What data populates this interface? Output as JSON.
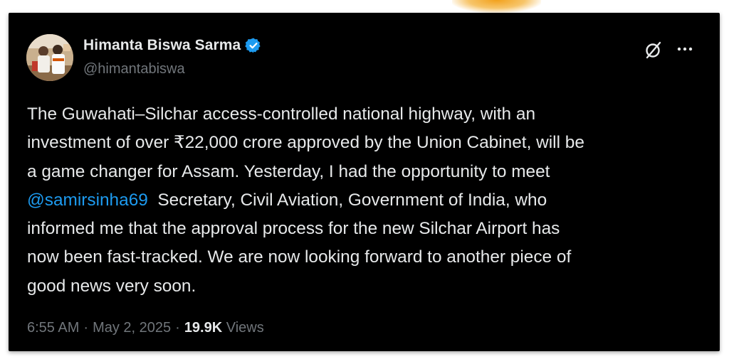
{
  "colors": {
    "card_background": "#000000",
    "text_primary": "#e7e9ea",
    "text_secondary": "#71767b",
    "mention_link": "#1d9bf0",
    "verified_badge": "#1d9bf0",
    "page_background": "#ffffff"
  },
  "tweet": {
    "author": {
      "name": "Himanta Biswa Sarma",
      "handle": "@himantabiswa",
      "verified_icon": "verified-badge-icon",
      "avatar": "profile-photo"
    },
    "actions": {
      "grok_icon": "grok-icon",
      "more_icon": "more-options-icon"
    },
    "body": {
      "line1": "The Guwahati–Silchar access-controlled national highway, with an",
      "line2": "investment of over ₹22,000 crore approved by the Union Cabinet, will be",
      "line3": "a game changer for Assam. Yesterday, I had the opportunity to meet",
      "mention": "@samirsinha69",
      "line4_rest": "  Secretary, Civil Aviation, Government of India, who",
      "line5": "informed me that the approval process for the new Silchar Airport has",
      "line6": "now been fast-tracked. We are now looking forward to another piece of",
      "line7": "good news very soon."
    },
    "meta": {
      "time": "6:55 AM",
      "separator": "·",
      "date": "May 2, 2025",
      "views_count": "19.9K",
      "views_label": "Views"
    }
  }
}
